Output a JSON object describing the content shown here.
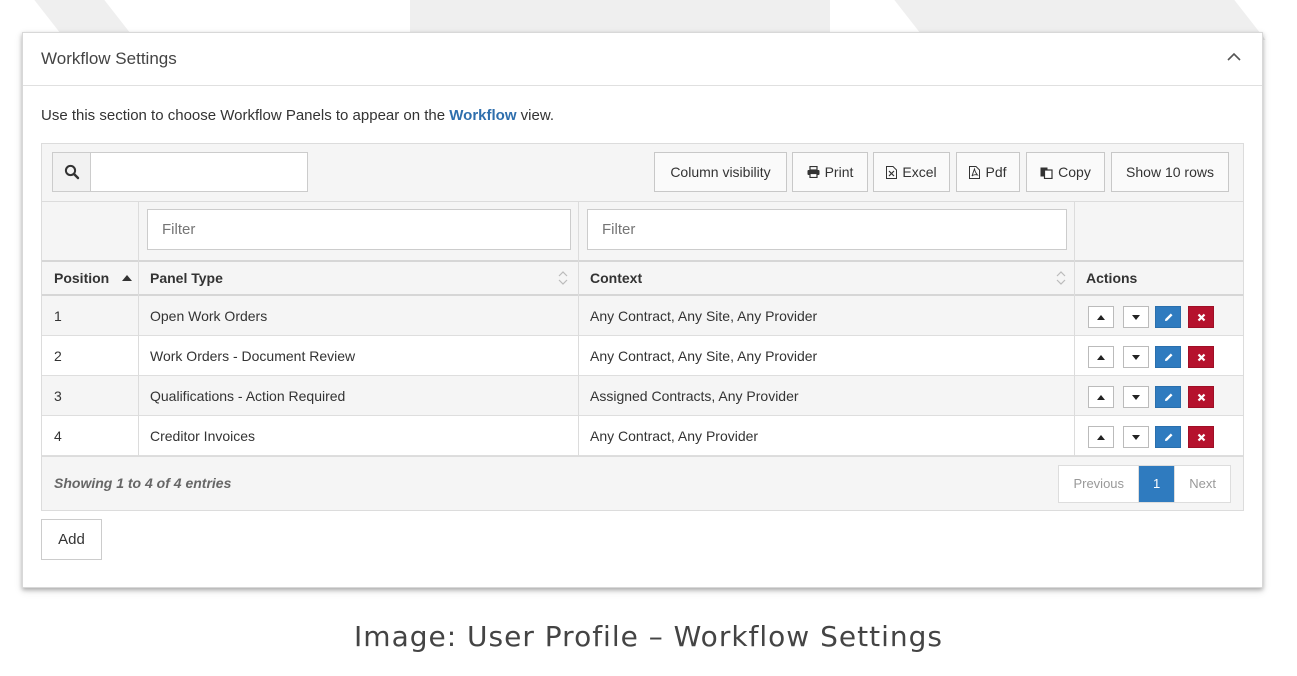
{
  "panel": {
    "title": "Workflow Settings",
    "intro_prefix": "Use this section to choose Workflow Panels to appear on the ",
    "intro_link": "Workflow",
    "intro_suffix": " view."
  },
  "toolbar": {
    "search_value": "",
    "buttons": {
      "column_visibility": "Column visibility",
      "print": "Print",
      "excel": "Excel",
      "pdf": "Pdf",
      "copy": "Copy",
      "show_rows": "Show 10 rows"
    }
  },
  "filters": {
    "panel_type_placeholder": "Filter",
    "context_placeholder": "Filter"
  },
  "columns": {
    "position": "Position",
    "panel_type": "Panel Type",
    "context": "Context",
    "actions": "Actions"
  },
  "rows": [
    {
      "position": "1",
      "panel_type": "Open Work Orders",
      "context": "Any Contract, Any Site, Any Provider"
    },
    {
      "position": "2",
      "panel_type": "Work Orders - Document Review",
      "context": "Any Contract, Any Site, Any Provider"
    },
    {
      "position": "3",
      "panel_type": "Qualifications - Action Required",
      "context": "Assigned Contracts, Any Provider"
    },
    {
      "position": "4",
      "panel_type": "Creditor Invoices",
      "context": "Any Contract, Any Provider"
    }
  ],
  "footer": {
    "showing": "Showing 1 to 4 of 4 entries",
    "pager": {
      "previous": "Previous",
      "current": "1",
      "next": "Next"
    }
  },
  "add_label": "Add",
  "caption": "Image: User Profile – Workflow Settings",
  "colors": {
    "accent": "#2f7bbf",
    "link": "#2f6fad",
    "danger": "#b5122d"
  }
}
